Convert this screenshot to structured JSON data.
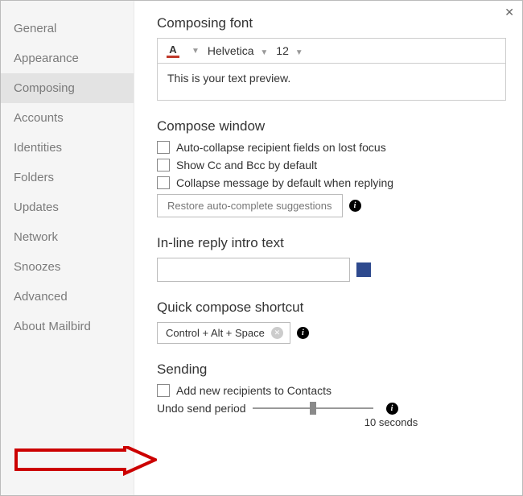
{
  "sidebar": {
    "items": [
      {
        "label": "General"
      },
      {
        "label": "Appearance"
      },
      {
        "label": "Composing",
        "selected": true
      },
      {
        "label": "Accounts"
      },
      {
        "label": "Identities"
      },
      {
        "label": "Folders"
      },
      {
        "label": "Updates"
      },
      {
        "label": "Network"
      },
      {
        "label": "Snoozes"
      },
      {
        "label": "Advanced"
      },
      {
        "label": "About Mailbird"
      }
    ]
  },
  "composingFont": {
    "title": "Composing font",
    "font_family": "Helvetica",
    "font_size": "12",
    "preview_text": "This is your text preview.",
    "text_color": "#c0392b"
  },
  "composeWindow": {
    "title": "Compose window",
    "options": [
      "Auto-collapse recipient fields on lost focus",
      "Show Cc and Bcc by default",
      "Collapse message by default when replying"
    ],
    "restore_button": "Restore auto-complete suggestions"
  },
  "inlineReply": {
    "title": "In-line reply intro text",
    "value": "",
    "color": "#2e4a8e"
  },
  "quickCompose": {
    "title": "Quick compose shortcut",
    "shortcut": "Control + Alt + Space"
  },
  "sending": {
    "title": "Sending",
    "add_recipients_label": "Add new recipients to Contacts",
    "undo_label": "Undo send period",
    "undo_value": "10 seconds"
  }
}
